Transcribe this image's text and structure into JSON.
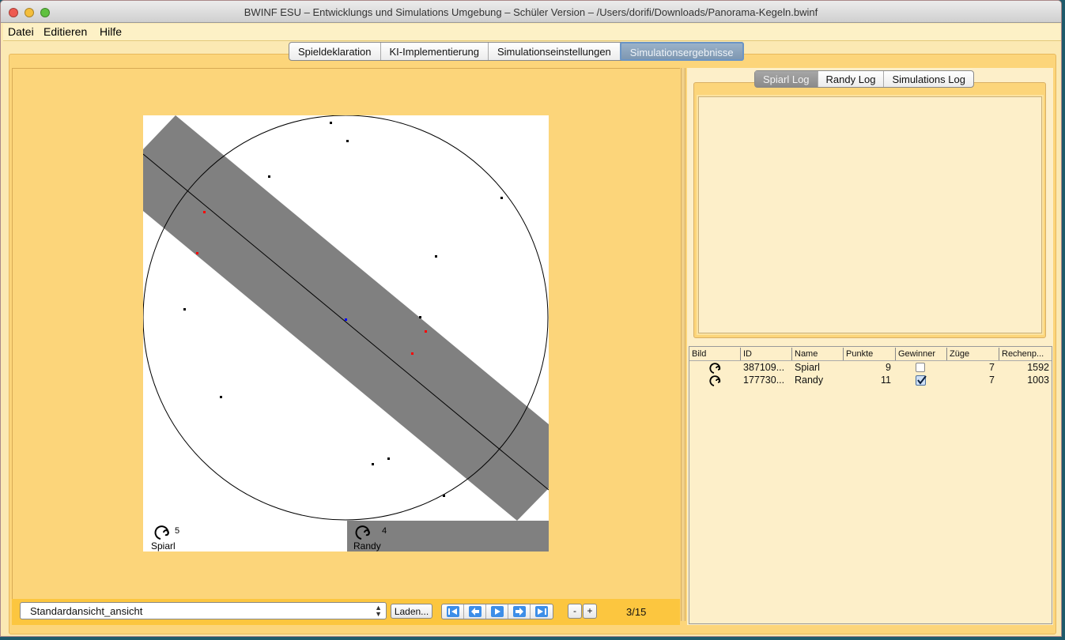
{
  "window": {
    "title": "BWINF ESU – Entwicklungs und Simulations Umgebung – Schüler Version – /Users/dorifi/Downloads/Panorama-Kegeln.bwinf"
  },
  "menu": {
    "items": [
      "Datei",
      "Editieren",
      "Hilfe"
    ]
  },
  "top_tabs": {
    "items": [
      "Spieldeklaration",
      "KI-Implementierung",
      "Simulationseinstellungen",
      "Simulationsergebnisse"
    ],
    "active": "Simulationsergebnisse"
  },
  "board": {
    "players": [
      {
        "name": "Spiarl",
        "score": "5"
      },
      {
        "name": "Randy",
        "score": "4"
      }
    ],
    "colors": {
      "band": "#808080",
      "black_pin": "#000000",
      "red_pin": "#ff0000",
      "center": "#0000ff"
    }
  },
  "log_tabs": {
    "items": [
      "Spiarl Log",
      "Randy Log",
      "Simulations Log"
    ],
    "active": "Spiarl Log",
    "content": ""
  },
  "results_table": {
    "columns": [
      "Bild",
      "ID",
      "Name",
      "Punkte",
      "Gewinner",
      "Züge",
      "Rechenp..."
    ],
    "rows": [
      {
        "icon": "player-icon",
        "id": "387109...",
        "name": "Spiarl",
        "punkte": "9",
        "gewinner": false,
        "zuege": "7",
        "rechenp": "1592"
      },
      {
        "icon": "player-icon",
        "id": "177730...",
        "name": "Randy",
        "punkte": "11",
        "gewinner": true,
        "zuege": "7",
        "rechenp": "1003"
      }
    ]
  },
  "bottom": {
    "view_select": "Standardansicht_ansicht",
    "load_label": "Laden...",
    "zoom_minus": "-",
    "zoom_plus": "+",
    "step_counter": "3/15",
    "nav_icons": [
      "first-icon",
      "prev-icon",
      "play-icon",
      "next-icon",
      "last-icon"
    ]
  },
  "theme": {
    "accent": "#fcd57a",
    "tab_active": "#8aa4bd"
  }
}
